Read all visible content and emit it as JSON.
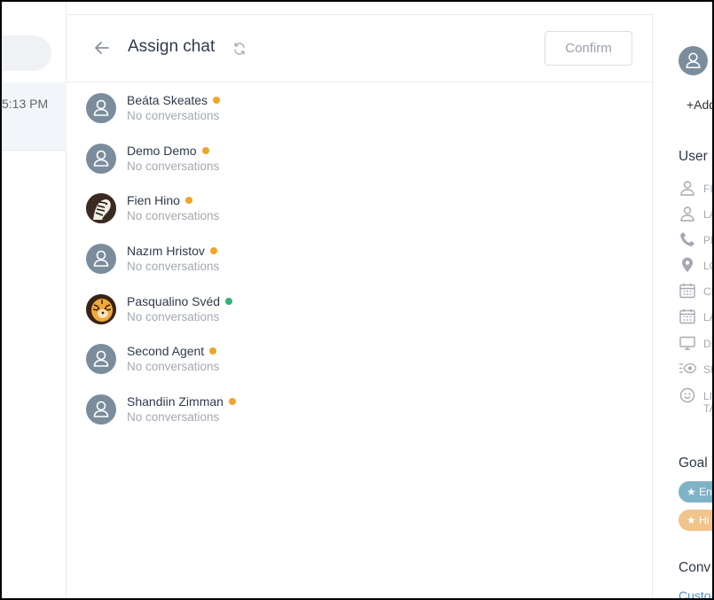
{
  "left": {
    "time": "5:13 PM"
  },
  "header": {
    "title": "Assign chat",
    "confirm_label": "Confirm"
  },
  "agents": [
    {
      "name": "Beáta Skeates",
      "status": "No conversations",
      "presence": "away",
      "avatar": "default"
    },
    {
      "name": "Demo Demo",
      "status": "No conversations",
      "presence": "away",
      "avatar": "default"
    },
    {
      "name": "Fien Hino",
      "status": "No conversations",
      "presence": "away",
      "avatar": "zebra"
    },
    {
      "name": "Nazım Hristov",
      "status": "No conversations",
      "presence": "away",
      "avatar": "default"
    },
    {
      "name": "Pasqualino Svéd",
      "status": "No conversations",
      "presence": "online",
      "avatar": "tiger"
    },
    {
      "name": "Second Agent",
      "status": "No conversations",
      "presence": "away",
      "avatar": "default"
    },
    {
      "name": "Shandiin Zimman",
      "status": "No conversations",
      "presence": "away",
      "avatar": "default"
    }
  ],
  "colors": {
    "away": "#f0a429",
    "online": "#2bb673",
    "avatar_bg": "#7b8d9c",
    "tag_blue": "#7fb3c8",
    "tag_orange": "#f0c48a"
  },
  "right": {
    "add_label": "+Add",
    "user_section": "User",
    "fields": [
      {
        "icon": "person-icon",
        "label": "FI"
      },
      {
        "icon": "person-icon",
        "label": "LA"
      },
      {
        "icon": "phone-icon",
        "label": "PH"
      },
      {
        "icon": "location-icon",
        "label": "LO"
      },
      {
        "icon": "calendar-icon",
        "label": "CR"
      },
      {
        "icon": "calendar-icon",
        "label": "LA"
      },
      {
        "icon": "monitor-icon",
        "label": "DE"
      },
      {
        "icon": "eye-list-icon",
        "label": "SE"
      },
      {
        "icon": "smile-chat-icon",
        "label": "LI",
        "label2": "TA"
      }
    ],
    "goal_section": "Goal",
    "tags": [
      {
        "label": "En"
      },
      {
        "label": "Hi"
      }
    ],
    "conv_section": "Conv",
    "conv_link": "Custo"
  }
}
